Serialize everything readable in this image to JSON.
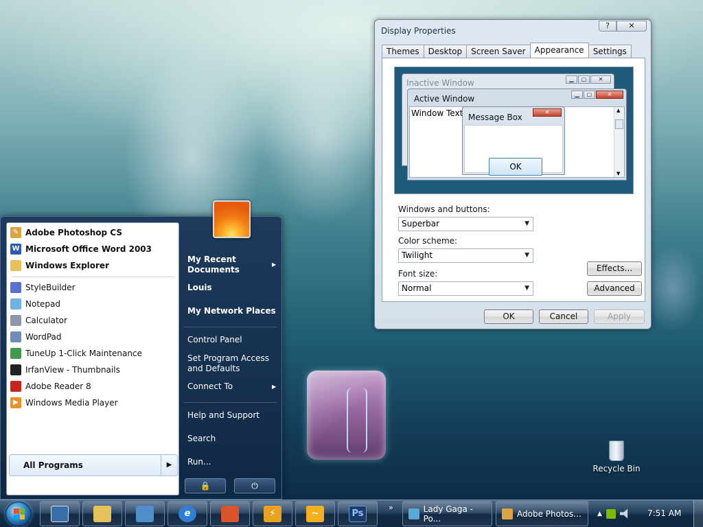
{
  "dialog": {
    "title": "Display Properties",
    "help_button": "?",
    "close_button": "✕",
    "tabs": [
      {
        "label": "Themes"
      },
      {
        "label": "Desktop"
      },
      {
        "label": "Screen Saver"
      },
      {
        "label": "Appearance",
        "active": true
      },
      {
        "label": "Settings"
      }
    ],
    "preview": {
      "inactive_title": "Inactive Window",
      "active_title": "Active Window",
      "window_text": "Window Text",
      "message_box_title": "Message Box",
      "message_box_ok": "OK"
    },
    "windows_buttons_label": "Windows and buttons:",
    "windows_buttons_value": "Superbar",
    "color_scheme_label": "Color scheme:",
    "color_scheme_value": "Twilight",
    "font_size_label": "Font size:",
    "font_size_value": "Normal",
    "effects_button": "Effects...",
    "advanced_button": "Advanced",
    "ok_button": "OK",
    "cancel_button": "Cancel",
    "apply_button": "Apply"
  },
  "start_menu": {
    "pinned": [
      {
        "label": "Adobe Photoshop CS",
        "icon": "photoshop-feather-icon",
        "color": "#d9a441"
      },
      {
        "label": "Microsoft Office Word 2003",
        "icon": "word-icon",
        "color": "#2a5db0"
      },
      {
        "label": "Windows Explorer",
        "icon": "folder-icon",
        "color": "#e7c25a"
      }
    ],
    "recent": [
      {
        "label": "StyleBuilder",
        "icon": "stylebuilder-icon",
        "color": "#5b6fd1"
      },
      {
        "label": "Notepad",
        "icon": "notepad-icon",
        "color": "#6fb2e3"
      },
      {
        "label": "Calculator",
        "icon": "calculator-icon",
        "color": "#8c98a6"
      },
      {
        "label": "WordPad",
        "icon": "wordpad-icon",
        "color": "#6d8fb8"
      },
      {
        "label": "TuneUp 1-Click Maintenance",
        "icon": "tuneup-icon",
        "color": "#3f9a4c"
      },
      {
        "label": "IrfanView - Thumbnails",
        "icon": "irfanview-icon",
        "color": "#222222"
      },
      {
        "label": "Adobe Reader 8",
        "icon": "adobe-reader-icon",
        "color": "#c8261c"
      },
      {
        "label": "Windows Media Player",
        "icon": "media-player-icon",
        "color": "#e8902a"
      }
    ],
    "all_programs": "All Programs",
    "right_items": {
      "recent_documents": "My Recent Documents",
      "user": "Louis",
      "network": "My Network Places",
      "control_panel": "Control Panel",
      "program_access": "Set Program Access and Defaults",
      "connect_to": "Connect To",
      "help": "Help and Support",
      "search": "Search",
      "run": "Run..."
    },
    "lock_icon": "🔒",
    "power_icon": "⏻"
  },
  "desktop": {
    "recycle_bin": "Recycle Bin"
  },
  "taskbar": {
    "pinned_icons": [
      {
        "icon": "show-desktop-icon",
        "color": "#3b6ea8"
      },
      {
        "icon": "explorer-folder-icon",
        "color": "#e7c25a"
      },
      {
        "icon": "network-computer-icon",
        "color": "#4f8fc9"
      },
      {
        "icon": "internet-explorer-icon",
        "color": "#2f7fd6"
      },
      {
        "icon": "office-icon",
        "color": "#d9542a"
      },
      {
        "icon": "tuneup-taskbar-icon",
        "color": "#e9a21f"
      },
      {
        "icon": "winamp-icon",
        "color": "#f2b01e"
      },
      {
        "icon": "photoshop-icon",
        "color": "#1c3b66",
        "text": "Ps"
      }
    ],
    "tasks": [
      {
        "label": "Lady Gaga - Po...",
        "icon": "music-icon",
        "color": "#5aa8d6"
      },
      {
        "label": "Adobe Photos...",
        "icon": "photoshop-feather-icon",
        "color": "#d9a441"
      }
    ],
    "overflow": "»",
    "tray_up": "▲",
    "clock": "7:51 AM"
  }
}
